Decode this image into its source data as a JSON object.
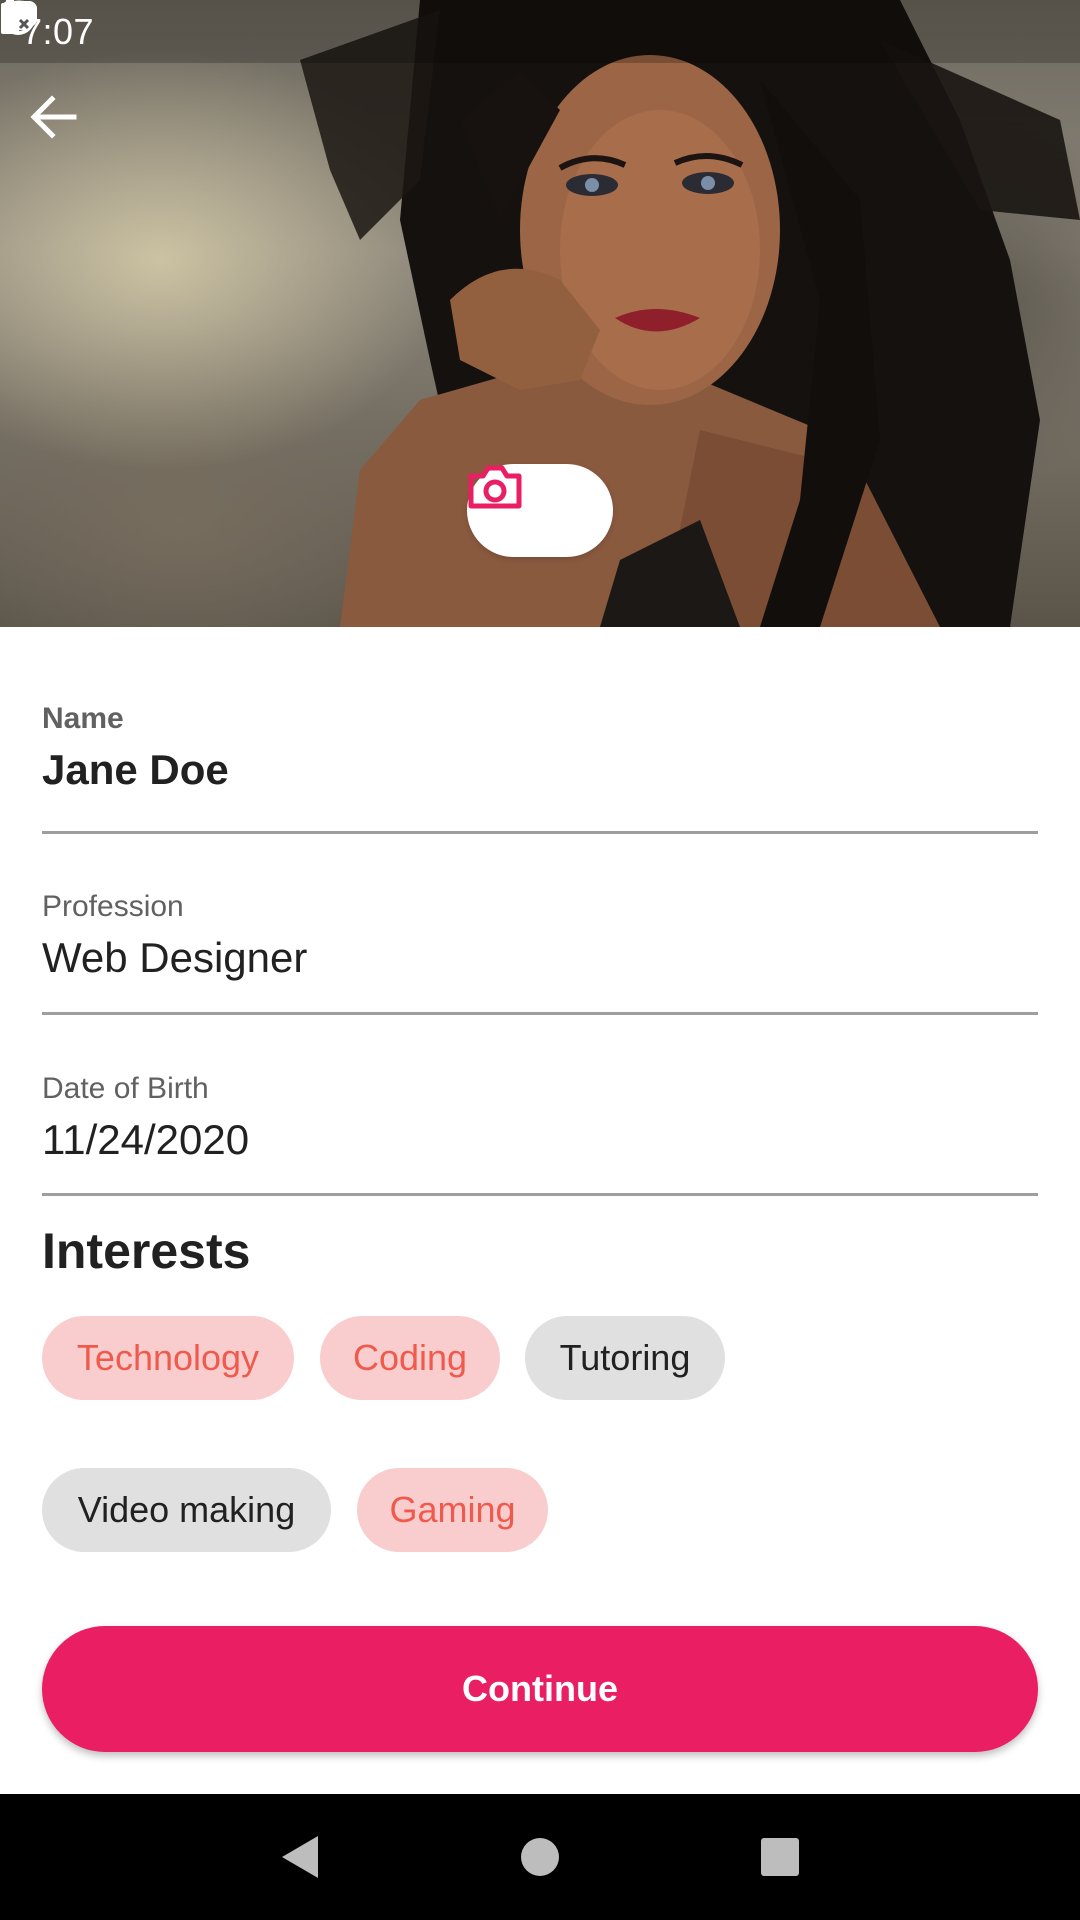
{
  "status_bar": {
    "time": "7:07",
    "left_icons": [
      "youtube-icon",
      "youtube-icon",
      "at-sign-icon"
    ],
    "right_icons": [
      "wifi-icon",
      "cell-signal-icon",
      "battery-icon"
    ]
  },
  "header": {
    "back_icon": "arrow-left-icon",
    "camera_icon": "camera-icon"
  },
  "form": {
    "name": {
      "label": "Name",
      "value": "Jane Doe"
    },
    "profession": {
      "label": "Profession",
      "value": "Web Designer"
    },
    "dob": {
      "label": "Date of Birth",
      "value": "11/24/2020"
    }
  },
  "interests": {
    "title": "Interests",
    "chips": [
      {
        "label": "Technology",
        "selected": true
      },
      {
        "label": "Coding",
        "selected": true
      },
      {
        "label": "Tutoring",
        "selected": false
      },
      {
        "label": "Video making",
        "selected": false
      },
      {
        "label": "Gaming",
        "selected": true
      }
    ]
  },
  "actions": {
    "continue_label": "Continue"
  },
  "nav_bar": {
    "icons": [
      "back-triangle-icon",
      "home-circle-icon",
      "recents-square-icon"
    ]
  },
  "colors": {
    "accent": "#e91e63",
    "chip_selected_bg": "#f9cdcd",
    "chip_selected_text": "#ef5a4c",
    "chip_unselected_bg": "#e0e0e0"
  }
}
